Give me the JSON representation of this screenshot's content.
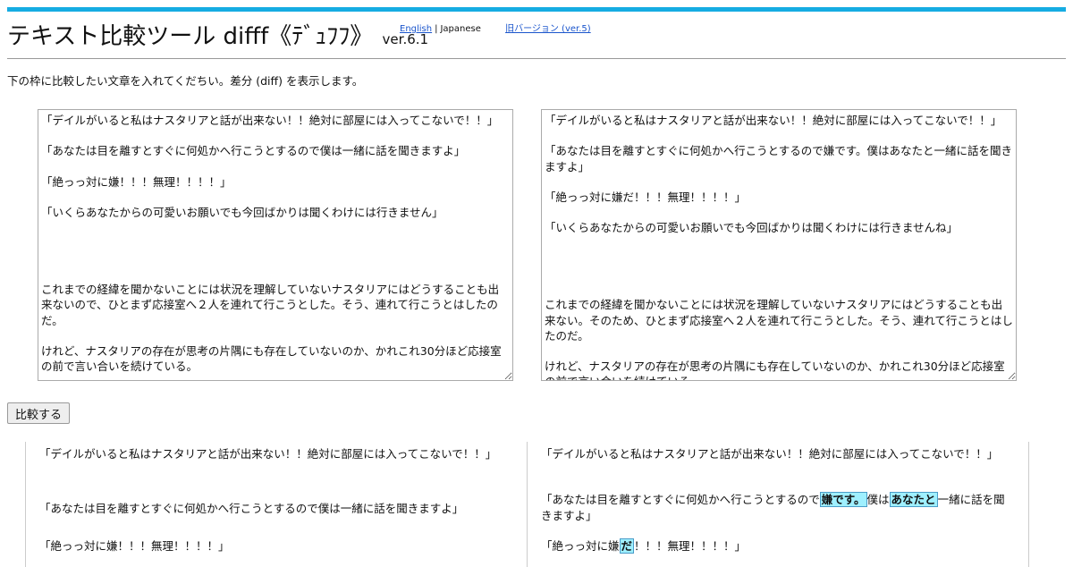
{
  "header": {
    "title": "テキスト比較ツール difff《ﾃﾞｭﾌﾌ》",
    "version": "ver.6.1",
    "lang_english": "English",
    "lang_separator": "|",
    "lang_japanese": "Japanese",
    "old_version_link": "旧バージョン (ver.5)"
  },
  "colors": {
    "accent_bar": "#16ace2",
    "diff_highlight": "#9ff0ff",
    "diff_border": "#4a9cc8",
    "link": "#1a55cc"
  },
  "intro": "下の枠に比較したい文章を入れてくだちい。差分 (diff) を表示します。",
  "input": {
    "left": "「デイルがいると私はナスタリアと話が出来ない！！絶対に部屋には入ってこないで！！」\n\n「あなたは目を離すとすぐに何処かへ行こうとするので僕は一緒に話を聞きますよ」\n\n「絶っっ対に嫌！！！無理！！！！」\n\n「いくらあなたからの可愛いお願いでも今回ばかりは聞くわけには行きません」\n\n\n\n\nこれまでの経緯を聞かないことには状況を理解していないナスタリアにはどうすることも出来ないので、ひとまず応接室へ２人を連れて行こうとした。そう、連れて行こうとはしたのだ。\n\nけれど、ナスタリアの存在が思考の片隅にも存在していないのか、かれこれ30分ほど応接室の前で言い合いを続けている。",
    "right": "「デイルがいると私はナスタリアと話が出来ない！！絶対に部屋には入ってこないで！！」\n\n「あなたは目を離すとすぐに何処かへ行こうとするので嫌です。僕はあなたと一緒に話を聞きますよ」\n\n「絶っっ対に嫌だ！！！無理！！！！」\n\n「いくらあなたからの可愛いお願いでも今回ばかりは聞くわけには行きませんね」\n\n\n\n\nこれまでの経緯を聞かないことには状況を理解していないナスタリアにはどうすることも出来ない。そのため、ひとまず応接室へ２人を連れて行こうとした。そう、連れて行こうとはしたのだ。\n\nけれど、ナスタリアの存在が思考の片隅にも存在していないのか、かれこれ30分ほど応接室の前で言い合いを続けている。"
  },
  "compare_button": "比較する",
  "result": {
    "left": {
      "p1": "「デイルがいると私はナスタリアと話が出来ない！！絶対に部屋には入ってこないで！！」",
      "p2": "「あなたは目を離すとすぐに何処かへ行こうとするので僕は一緒に話を聞きますよ」",
      "p3": "「絶っっ対に嫌！！！無理！！！！」"
    },
    "right": {
      "p1": "「デイルがいると私はナスタリアと話が出来ない！！絶対に部屋には入ってこないで！！」",
      "p2_a": "「あなたは目を離すとすぐに何処かへ行こうとするので",
      "p2_diff1": "嫌です。",
      "p2_b": "僕は",
      "p2_diff2": "あなたと",
      "p2_c": "一緒に話を聞きますよ」",
      "p3_a": "「絶っっ対に嫌",
      "p3_diff1": "だ",
      "p3_b": "！！！無理！！！！」"
    }
  }
}
